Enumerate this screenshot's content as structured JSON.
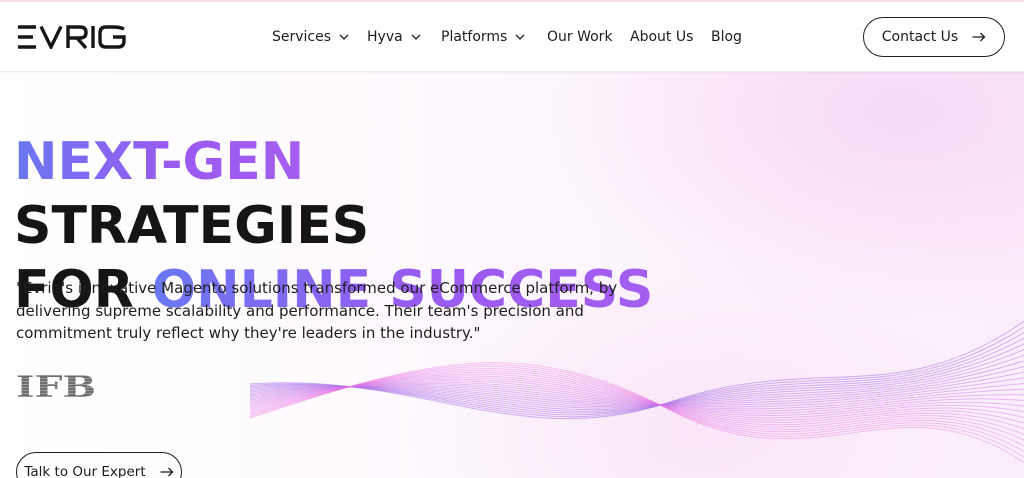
{
  "brand": {
    "logo_text": "EVRIG",
    "logo_icon": "evrig-wordmark-icon"
  },
  "nav": {
    "items": [
      {
        "label": "Services",
        "dropdown": true
      },
      {
        "label": "Hyva",
        "dropdown": true
      },
      {
        "label": "Platforms",
        "dropdown": true
      },
      {
        "label": "Our Work",
        "dropdown": false
      },
      {
        "label": "About Us",
        "dropdown": false
      },
      {
        "label": "Blog",
        "dropdown": false
      }
    ],
    "contact_label": "Contact Us",
    "contact_icon": "arrow-right-icon"
  },
  "hero": {
    "headline": {
      "line1_accent": "NEXT-GEN",
      "line1_rest": "STRATEGIES",
      "line2_lead": "FOR",
      "line2_accent": "ONLINE SUCCESS"
    },
    "quote": "\"Evrig's innovative Magento solutions transformed our eCommerce platform, by delivering supreme scalability and performance. Their team's precision and commitment truly reflect why they're leaders in the industry.\"",
    "client_logo_text": "IFB",
    "cta_label": "Talk to Our Expert",
    "cta_icon": "arrow-right-icon"
  },
  "colors": {
    "gradient_start": "#6a78f2",
    "gradient_end": "#a45ef0",
    "text_dark": "#151515",
    "wave_line": "#b98ef0",
    "background_tint": "#fbeefb"
  }
}
